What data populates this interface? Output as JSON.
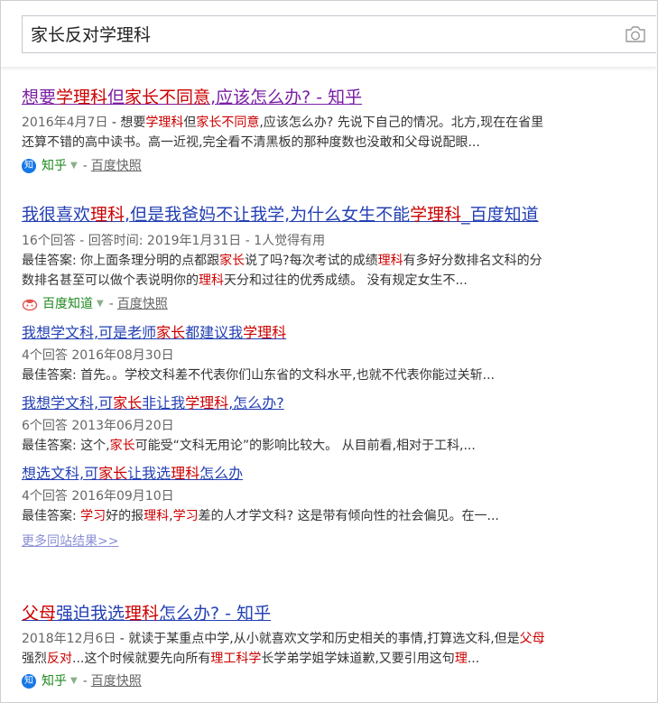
{
  "search": {
    "query": "家长反对学理科"
  },
  "results": [
    {
      "title": [
        [
          "想要",
          false
        ],
        [
          "学理科",
          true
        ],
        [
          "但",
          false
        ],
        [
          "家长不同意",
          true
        ],
        [
          ",应该怎么办? - 知乎",
          false
        ]
      ],
      "date": "2016年4月7日",
      "snippet_lines": [
        [
          [
            " - 想要",
            false
          ],
          [
            "学理科",
            true
          ],
          [
            "但",
            false
          ],
          [
            "家长不同意",
            true
          ],
          [
            ",应该怎么办? 先说下自己的情况。北方,现在在省里",
            false
          ]
        ],
        [
          [
            "还算不错的高中读书。高一近视,完全看不清黑板的那种度数也没敢和父母说配眼...",
            false
          ]
        ]
      ],
      "source": {
        "icon_text": "知",
        "name": "知乎",
        "kuaizhao": "百度快照"
      }
    },
    {
      "title": [
        [
          "我很喜欢",
          false
        ],
        [
          "理科",
          true
        ],
        [
          ",但是我爸妈不让我学,为什么女生不能",
          false
        ],
        [
          "学理科",
          true
        ],
        [
          "_百度知道",
          false
        ]
      ],
      "meta": "16个回答 - 回答时间: 2019年1月31日 - 1人觉得有用",
      "snippet_lines": [
        [
          [
            "最佳答案: 你上面条理分明的点都跟",
            false
          ],
          [
            "家长",
            true
          ],
          [
            "说了吗?每次考试的成绩",
            false
          ],
          [
            "理科",
            true
          ],
          [
            "有多好分数排名文科的分",
            false
          ]
        ],
        [
          [
            "数排名甚至可以做个表说明你的",
            false
          ],
          [
            "理科",
            true
          ],
          [
            "天分和过往的优秀成绩。 没有规定女生不...",
            false
          ]
        ]
      ],
      "source": {
        "name": "百度知道",
        "kuaizhao": "百度快照"
      },
      "subs": [
        {
          "title": [
            [
              "我想学文科,可是老师",
              false
            ],
            [
              "家长",
              true
            ],
            [
              "都建议我",
              false
            ],
            [
              "学理科",
              true
            ]
          ],
          "meta": "4个回答   2016年08月30日",
          "snippet": [
            [
              "最佳答案:  首先。。学校文科差不代表你们山东省的文科水平,也就不代表你能过关斩...",
              false
            ]
          ]
        },
        {
          "title": [
            [
              "我想学文科,可",
              false
            ],
            [
              "家长",
              true
            ],
            [
              "非让我",
              false
            ],
            [
              "学理科",
              true
            ],
            [
              ",怎么办?",
              false
            ]
          ],
          "meta": "6个回答   2013年06月20日",
          "snippet": [
            [
              "最佳答案:  这个,",
              false
            ],
            [
              "家长",
              true
            ],
            [
              "可能受“文科无用论”的影响比较大。 从目前看,相对于工科,...",
              false
            ]
          ]
        },
        {
          "title": [
            [
              "想选文科,可",
              false
            ],
            [
              "家长",
              true
            ],
            [
              "让我选",
              false
            ],
            [
              "理科",
              true
            ],
            [
              "怎么办",
              false
            ]
          ],
          "meta": "4个回答   2016年09月10日",
          "snippet": [
            [
              "最佳答案:  ",
              false
            ],
            [
              "学习",
              true
            ],
            [
              "好的报",
              false
            ],
            [
              "理科",
              true
            ],
            [
              ",",
              false
            ],
            [
              "学习",
              true
            ],
            [
              "差的人才学文科? 这是带有倾向性的社会偏见。在一...",
              false
            ]
          ]
        }
      ],
      "more": "更多同站结果>>"
    },
    {
      "title": [
        [
          "父母",
          true
        ],
        [
          "强迫我选",
          false
        ],
        [
          "理科",
          true
        ],
        [
          "怎么办? - 知乎",
          false
        ]
      ],
      "date": "2018年12月6日",
      "snippet_lines": [
        [
          [
            " - 就读于某重点中学,从小就喜欢文学和历史相关的事情,打算选文科,但是",
            false
          ],
          [
            "父母",
            true
          ]
        ],
        [
          [
            "强烈",
            false
          ],
          [
            "反对",
            true
          ],
          [
            "...这个时候就要先向所有",
            false
          ],
          [
            "理工科学",
            true
          ],
          [
            "长学弟学姐学妹道歉,又要引用这句",
            false
          ],
          [
            "理",
            true
          ],
          [
            "...",
            false
          ]
        ]
      ],
      "source": {
        "icon_text": "知",
        "name": "知乎",
        "kuaizhao": "百度快照"
      }
    }
  ],
  "colors": {
    "link": "#2440b3",
    "visited": "#7a1fa2",
    "highlight": "#cc0000",
    "source": "#1f8a1f"
  }
}
